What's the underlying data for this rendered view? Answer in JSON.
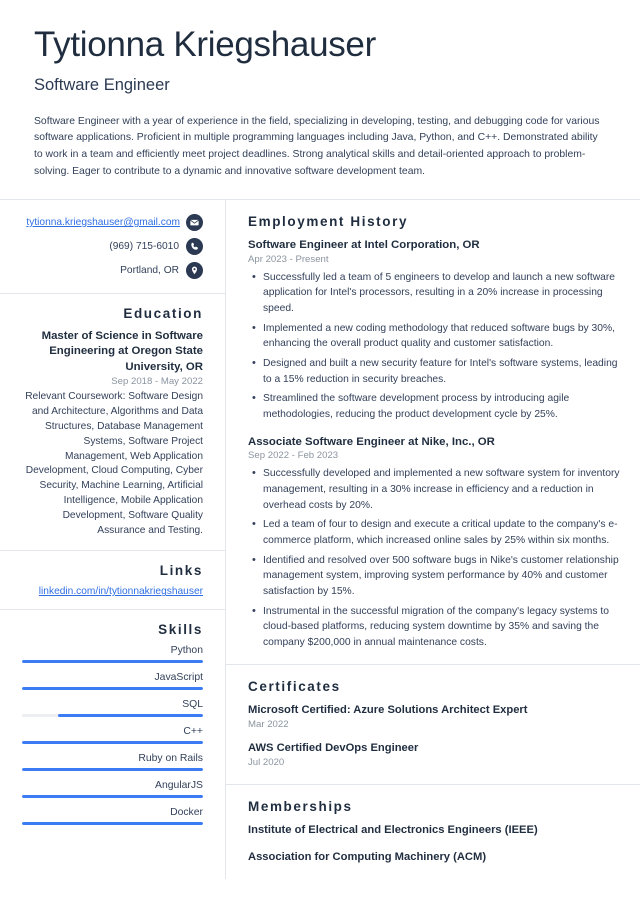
{
  "accent_color": "#3b7cf5",
  "link_color": "#2f6fe4",
  "heading_color": "#1f2d3f",
  "muted_color": "#8b949f",
  "header": {
    "name": "Tytionna Kriegshauser",
    "job_title": "Software Engineer",
    "summary": "Software Engineer with a year of experience in the field, specializing in developing, testing, and debugging code for various software applications. Proficient in multiple programming languages including Java, Python, and C++. Demonstrated ability to work in a team and efficiently meet project deadlines. Strong analytical skills and detail-oriented approach to problem-solving. Eager to contribute to a dynamic and innovative software development team."
  },
  "contact": {
    "email": "tytionna.kriegshauser@gmail.com",
    "phone": "(969) 715-6010",
    "location": "Portland, OR",
    "email_icon": "envelope-icon",
    "phone_icon": "phone-icon",
    "location_icon": "map-pin-icon"
  },
  "education": {
    "title": "Education",
    "degree": "Master of Science in Software Engineering at Oregon State University, OR",
    "date": "Sep 2018 - May 2022",
    "description": "Relevant Coursework: Software Design and Architecture, Algorithms and Data Structures, Database Management Systems, Software Project Management, Web Application Development, Cloud Computing, Cyber Security, Machine Learning, Artificial Intelligence, Mobile Application Development, Software Quality Assurance and Testing."
  },
  "links": {
    "title": "Links",
    "items": [
      {
        "label": "linkedin.com/in/tytionnakriegshauser"
      }
    ]
  },
  "skills": {
    "title": "Skills",
    "items": [
      {
        "name": "Python",
        "fill_start": 0,
        "fill_end": 100
      },
      {
        "name": "JavaScript",
        "fill_start": 0,
        "fill_end": 100
      },
      {
        "name": "SQL",
        "fill_start": 20,
        "fill_end": 100
      },
      {
        "name": "C++",
        "fill_start": 0,
        "fill_end": 100
      },
      {
        "name": "Ruby on Rails",
        "fill_start": 0,
        "fill_end": 100
      },
      {
        "name": "AngularJS",
        "fill_start": 0,
        "fill_end": 100
      },
      {
        "name": "Docker",
        "fill_start": 0,
        "fill_end": 100
      }
    ]
  },
  "employment": {
    "title": "Employment History",
    "jobs": [
      {
        "heading": "Software Engineer at Intel Corporation, OR",
        "date": "Apr 2023 - Present",
        "bullets": [
          "Successfully led a team of 5 engineers to develop and launch a new software application for Intel's processors, resulting in a 20% increase in processing speed.",
          "Implemented a new coding methodology that reduced software bugs by 30%, enhancing the overall product quality and customer satisfaction.",
          "Designed and built a new security feature for Intel's software systems, leading to a 15% reduction in security breaches.",
          "Streamlined the software development process by introducing agile methodologies, reducing the product development cycle by 25%."
        ]
      },
      {
        "heading": "Associate Software Engineer at Nike, Inc., OR",
        "date": "Sep 2022 - Feb 2023",
        "bullets": [
          "Successfully developed and implemented a new software system for inventory management, resulting in a 30% increase in efficiency and a reduction in overhead costs by 20%.",
          "Led a team of four to design and execute a critical update to the company's e-commerce platform, which increased online sales by 25% within six months.",
          "Identified and resolved over 500 software bugs in Nike's customer relationship management system, improving system performance by 40% and customer satisfaction by 15%.",
          "Instrumental in the successful migration of the company's legacy systems to cloud-based platforms, reducing system downtime by 35% and saving the company $200,000 in annual maintenance costs."
        ]
      }
    ]
  },
  "certificates": {
    "title": "Certificates",
    "items": [
      {
        "name": "Microsoft Certified: Azure Solutions Architect Expert",
        "date": "Mar 2022"
      },
      {
        "name": "AWS Certified DevOps Engineer",
        "date": "Jul 2020"
      }
    ]
  },
  "memberships": {
    "title": "Memberships",
    "items": [
      {
        "name": "Institute of Electrical and Electronics Engineers (IEEE)"
      },
      {
        "name": "Association for Computing Machinery (ACM)"
      }
    ]
  }
}
